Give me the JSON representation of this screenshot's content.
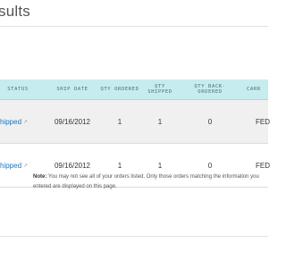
{
  "page": {
    "heading": "sults"
  },
  "table": {
    "columns": [
      "Status",
      "Ship Date",
      "Qty Ordered",
      "Qty Shipped",
      "Qty Back-Ordered",
      "Carr"
    ],
    "rows": [
      {
        "status": "hipped",
        "ship_date": "09/16/2012",
        "qty_ordered": "1",
        "qty_shipped": "1",
        "qty_back_ordered": "0",
        "carrier": "FED"
      },
      {
        "status": "hipped",
        "ship_date": "09/16/2012",
        "qty_ordered": "1",
        "qty_shipped": "1",
        "qty_back_ordered": "0",
        "carrier": "FED"
      }
    ]
  },
  "note": {
    "label": "Note:",
    "text": " You may not see all of your orders listed. Only those orders matching the information you entered are displayed on this page."
  },
  "icons": {
    "status_link_icon": "external-link-icon"
  },
  "colors": {
    "header_bg": "#c7ecef",
    "link": "#1b75bb",
    "alt_row_bg": "#f0f0f0"
  }
}
